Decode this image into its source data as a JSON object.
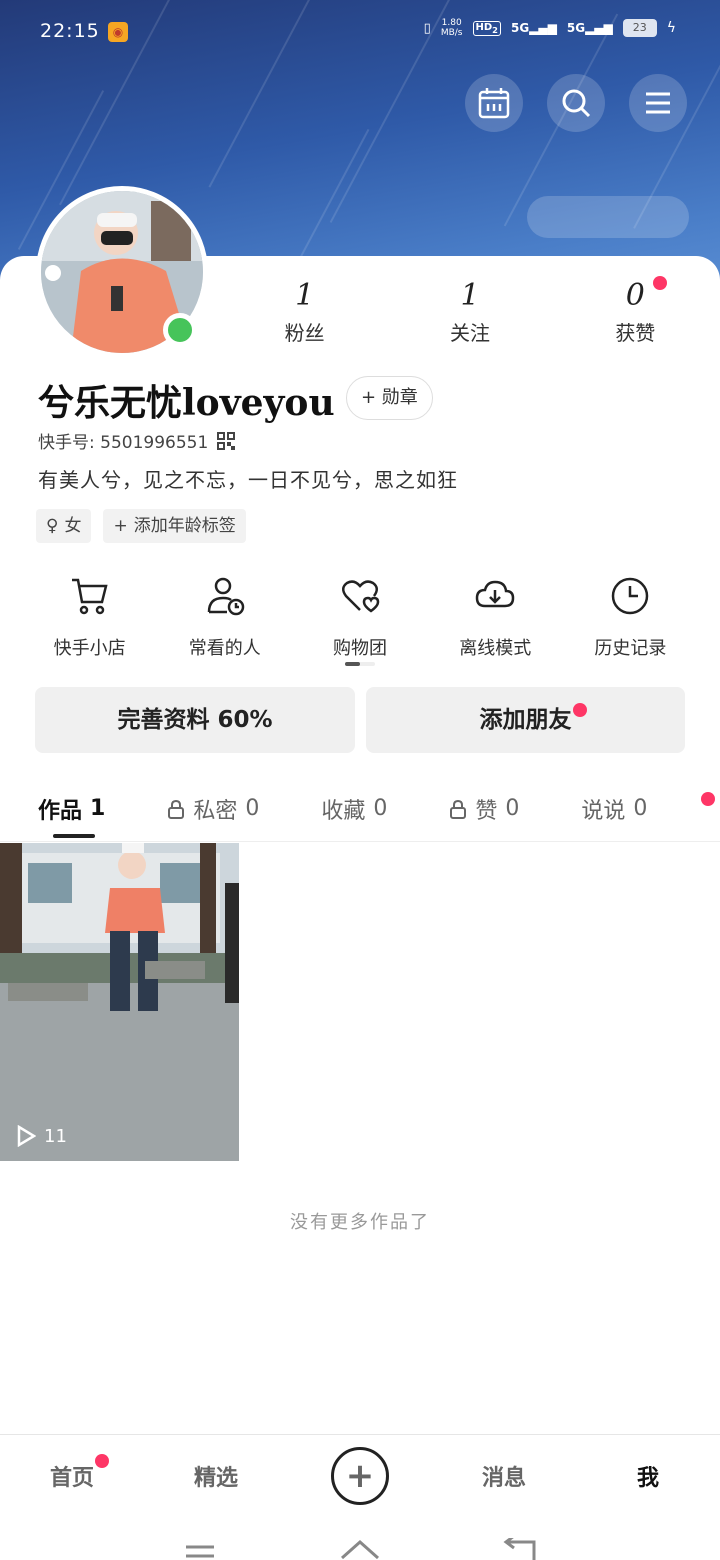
{
  "status_bar": {
    "time": "22:15",
    "net_speed_value": "1.80",
    "net_speed_unit": "MB/s",
    "hd": "HD",
    "hd_sub": "2",
    "signal1": "5G",
    "signal2": "5G",
    "battery": "23"
  },
  "stats": [
    {
      "value": "1",
      "label": "粉丝"
    },
    {
      "value": "1",
      "label": "关注"
    },
    {
      "value": "0",
      "label": "获赞"
    }
  ],
  "profile": {
    "username": "兮乐无忧loveyou",
    "medal_label": "+ 勋章",
    "kuaishou_id": "快手号: 5501996551",
    "bio": "有美人兮，见之不忘，一日不见兮，思之如狂",
    "tags": [
      "女",
      "添加年龄标签"
    ]
  },
  "shortcuts": [
    {
      "label": "快手小店",
      "icon": "cart-icon"
    },
    {
      "label": "常看的人",
      "icon": "person-clock-icon"
    },
    {
      "label": "购物团",
      "icon": "heart-cart-icon"
    },
    {
      "label": "离线模式",
      "icon": "download-cloud-icon"
    },
    {
      "label": "历史记录",
      "icon": "history-icon"
    }
  ],
  "actions": {
    "complete_profile": "完善资料 60%",
    "add_friends": "添加朋友"
  },
  "tabs": [
    {
      "label": "作品",
      "count": "1",
      "locked": false
    },
    {
      "label": "私密",
      "count": "0",
      "locked": true
    },
    {
      "label": "收藏",
      "count": "0",
      "locked": false
    },
    {
      "label": "赞",
      "count": "0",
      "locked": true
    },
    {
      "label": "说说",
      "count": "0",
      "locked": false
    }
  ],
  "video": {
    "play_count": "11"
  },
  "no_more_text": "没有更多作品了",
  "bottom_nav": {
    "home": "首页",
    "featured": "精选",
    "messages": "消息",
    "me": "我"
  },
  "colors": {
    "accent_red": "#fe3666",
    "online_green": "#46c45a"
  }
}
